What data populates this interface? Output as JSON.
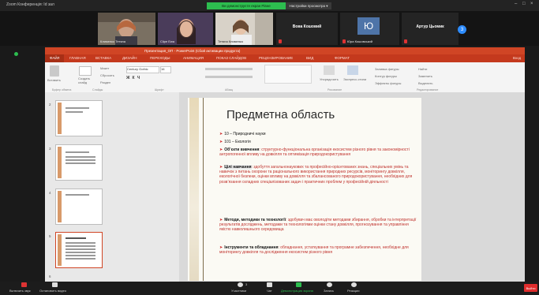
{
  "zoom": {
    "window_title": "Zoom Конференція: Id зал",
    "share_status": "Ви демонструєте екран Рівне",
    "share_settings": "Настройки просмотра ▾",
    "participants": [
      {
        "name": "Клименко Тетяна",
        "kind": "video"
      },
      {
        "name": "Clipe Ewa",
        "kind": "video"
      },
      {
        "name": "Тетяна Клименко",
        "kind": "video"
      },
      {
        "name": "Вова Кошовий",
        "kind": "name"
      },
      {
        "name": "Юра Кошовський",
        "kind": "avatar",
        "initials": "Ю"
      },
      {
        "name": "Артур Цьомик",
        "kind": "name"
      }
    ],
    "participant_count": "3",
    "toolbar": {
      "mute": "Включить звук",
      "stop_video": "Остановить видео",
      "participants": "Участники",
      "participants_count": "3",
      "chat": "Чат",
      "share": "Демонстрация экрана",
      "record": "Запись",
      "reactions": "Реакции",
      "end": "Выйти"
    }
  },
  "ppt": {
    "title": "Презентация_ОП - PowerPoint (Сбой активации продукта)",
    "tabs": [
      "ФАЙЛ",
      "ГЛАВНАЯ",
      "ВСТАВКА",
      "ДИЗАЙН",
      "ПЕРЕХОДЫ",
      "АНИМАЦИЯ",
      "ПОКАЗ СЛАЙДОВ",
      "РЕЦЕНЗИРОВАНИЕ",
      "ВИД",
      "ФОРМАТ"
    ],
    "signin": "Вход",
    "ribbon": {
      "paste": "Вставить",
      "create_slide": "Создать слайд",
      "layout": "Макет",
      "reset": "Сбросить",
      "section": "Раздел",
      "font_name": "Century Gothic",
      "font_size": "16",
      "fill": "Заливка фигуры",
      "outline": "Контур фигуры",
      "effects": "Эффекты фигуры",
      "arrange": "Упорядочить",
      "styles": "Экспресс-стили",
      "find": "Найти",
      "replace": "Заменить",
      "select": "Выделить",
      "groups": [
        "Буфер обмена",
        "Слайды",
        "Шрифт",
        "Абзац",
        "Рисование",
        "Редактирование"
      ]
    },
    "thumb_numbers": [
      "2",
      "3",
      "4",
      "5",
      "6"
    ],
    "slide": {
      "title": "Предметна область",
      "bullets": [
        {
          "label": "",
          "text": "10 – Природничі науки"
        },
        {
          "label": "",
          "text": "101 – Екологія"
        },
        {
          "label": "Об’єкти вивчення",
          "text": ": структурно-функціональна організація екосистем різного рівня та закономірності антропогенної впливу на довкілля та оптимізація природокористування"
        },
        {
          "label": "Цілі навчання",
          "text": ": здобуття загальнонаукових та професійно-орієнтованих знань, спеціальних умінь та навичок з питань охорони та раціонального використання природних ресурсів, моніторингу довкілля, екологічної безпеки, оцінки впливу на довкілля та збалансованого природокористування, необхідних для розв’язання складних спеціалізованих задач і практичних проблем у професійній діяльності"
        },
        {
          "label": "Методи, методики та технології",
          "text": ": здобувач має оволодіти методами збирання, обробки та інтерпретації результатів досліджень, методами та технологіями оцінки стану довкілля, прогнозування та управління якістю навколишнього середовища"
        },
        {
          "label": "Інструменти та обладнання",
          "text": ": обладнання, устаткування та програмне забезпечення, необхідне для моніторингу довкілля та дослідження екосистем різного рівня"
        }
      ]
    }
  }
}
